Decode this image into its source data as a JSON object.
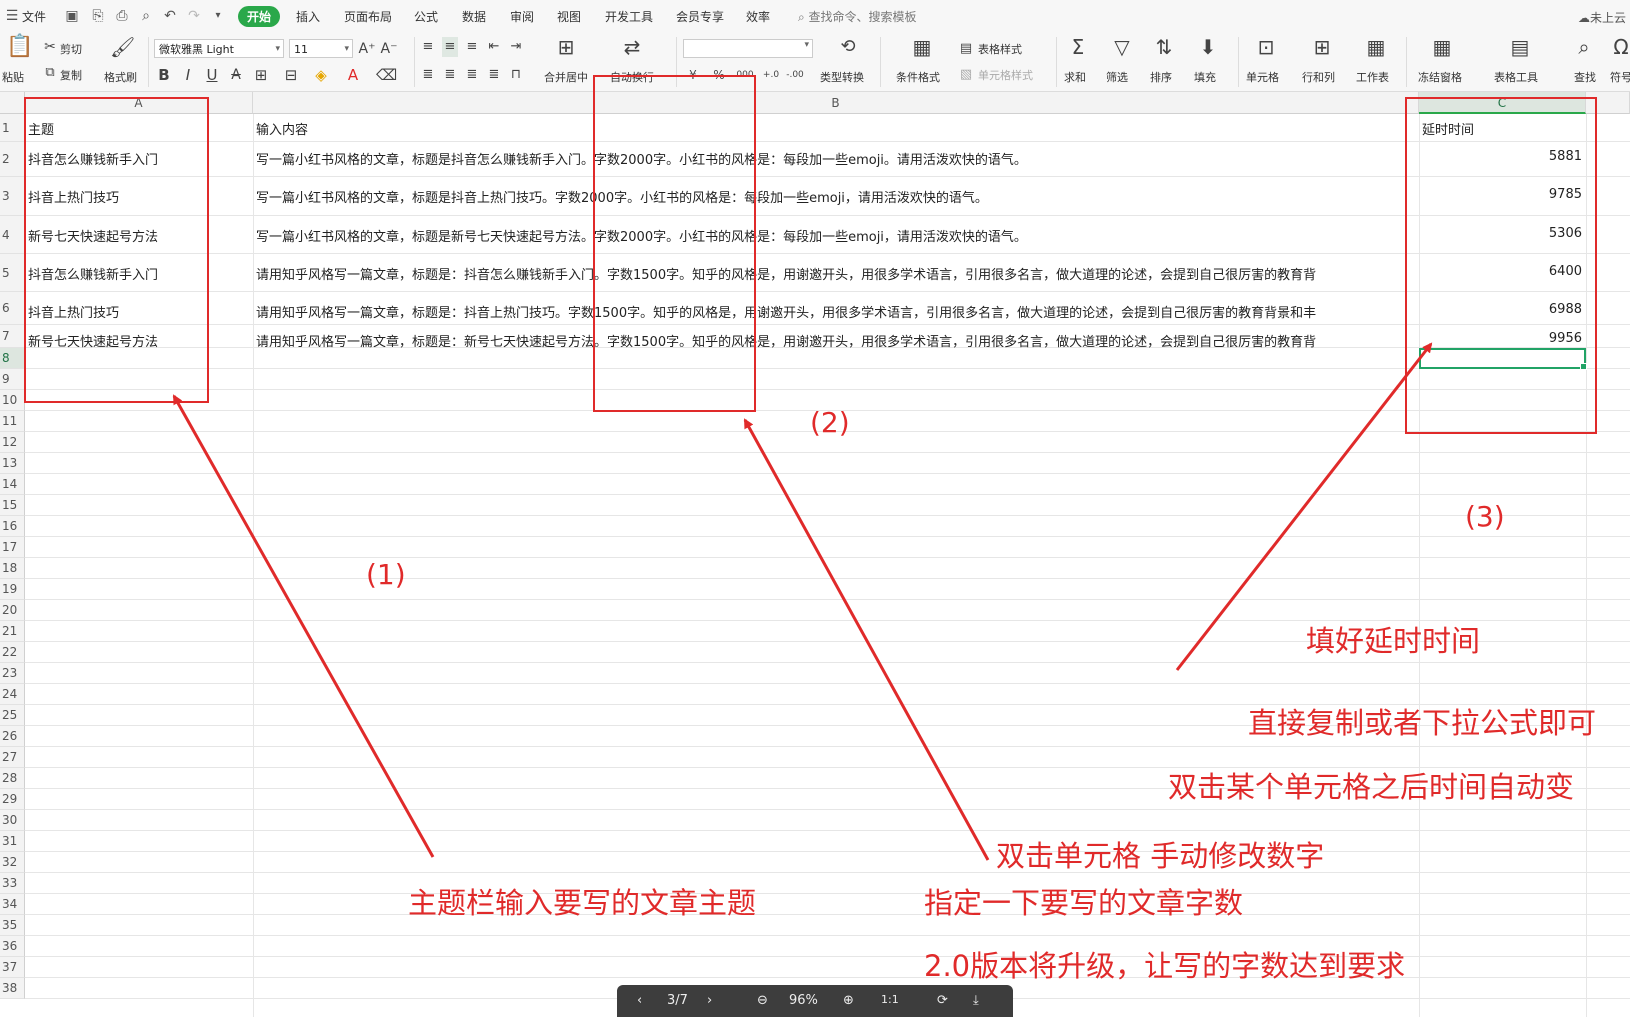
{
  "menu": {
    "file": "文件",
    "tabs": [
      "开始",
      "插入",
      "页面布局",
      "公式",
      "数据",
      "审阅",
      "视图",
      "开发工具",
      "会员专享",
      "效率"
    ],
    "search_placeholder": "查找命令、搜索模板",
    "cloud": "未上云"
  },
  "ribbon": {
    "paste": "粘贴",
    "cut": "剪切",
    "copy": "复制",
    "format_painter": "格式刷",
    "font_name": "微软雅黑 Light",
    "font_size": "11",
    "merge_center": "合并居中",
    "wrap_text": "自动换行",
    "type_convert": "类型转换",
    "conditional_format": "条件格式",
    "table_style": "表格样式",
    "cell_style": "单元格样式",
    "sum": "求和",
    "filter": "筛选",
    "sort": "排序",
    "fill": "填充",
    "cell": "单元格",
    "row_col": "行和列",
    "worksheet": "工作表",
    "freeze": "冻结窗格",
    "table_tools": "表格工具",
    "find": "查找",
    "symbol": "符号"
  },
  "columns": [
    "A",
    "B",
    "C"
  ],
  "rows": [
    "1",
    "2",
    "3",
    "4",
    "5",
    "6",
    "7",
    "8",
    "9",
    "10",
    "11",
    "12",
    "13",
    "14",
    "15",
    "16",
    "17",
    "18",
    "19",
    "20",
    "21",
    "22",
    "23",
    "24",
    "25",
    "26",
    "27",
    "28",
    "29",
    "30",
    "31",
    "32",
    "33",
    "34",
    "35",
    "36",
    "37",
    "38"
  ],
  "header": {
    "a": "主题",
    "b": "输入内容",
    "c": "延时时间"
  },
  "data": [
    {
      "a": "抖音怎么赚钱新手入门",
      "b": "写一篇小红书风格的文章，标题是抖音怎么赚钱新手入门。字数2000字。小红书的风格是：每段加一些emoji。请用活泼欢快的语气。",
      "c": "5881"
    },
    {
      "a": "抖音上热门技巧",
      "b": "写一篇小红书风格的文章，标题是抖音上热门技巧。字数2000字。小红书的风格是：每段加一些emoji，请用活泼欢快的语气。",
      "c": "9785"
    },
    {
      "a": "新号七天快速起号方法",
      "b": "写一篇小红书风格的文章，标题是新号七天快速起号方法。字数2000字。小红书的风格是：每段加一些emoji，请用活泼欢快的语气。",
      "c": "5306"
    },
    {
      "a": "抖音怎么赚钱新手入门",
      "b": "请用知乎风格写一篇文章，标题是：抖音怎么赚钱新手入门。字数1500字。知乎的风格是，用谢邀开头，用很多学术语言，引用很多名言，做大道理的论述，会提到自己很厉害的教育背",
      "c": "6400"
    },
    {
      "a": "抖音上热门技巧",
      "b": "请用知乎风格写一篇文章，标题是：抖音上热门技巧。字数1500字。知乎的风格是，用谢邀开头，用很多学术语言，引用很多名言，做大道理的论述，会提到自己很厉害的教育背景和丰",
      "c": "6988"
    },
    {
      "a": "新号七天快速起号方法",
      "b": "请用知乎风格写一篇文章，标题是：新号七天快速起号方法。字数1500字。知乎的风格是，用谢邀开头，用很多学术语言，引用很多名言，做大道理的论述，会提到自己很厉害的教育背",
      "c": "9956"
    }
  ],
  "annotations": {
    "label1": "(1)",
    "label2": "(2)",
    "label3": "(3)",
    "note1": "主题栏输入要写的文章主题",
    "note2a": "双击单元格 手动修改数字",
    "note2b": "指定一下要写的文章字数",
    "note2c": "2.0版本将升级，让写的字数达到要求",
    "note3a": "填好延时时间",
    "note3b": "直接复制或者下拉公式即可",
    "note3c": "双击某个单元格之后时间自动变"
  },
  "pdf_toolbar": {
    "page": "3/7",
    "zoom": "96%"
  },
  "colors": {
    "accent": "#2aa84a",
    "annotation": "#e02a2a"
  }
}
